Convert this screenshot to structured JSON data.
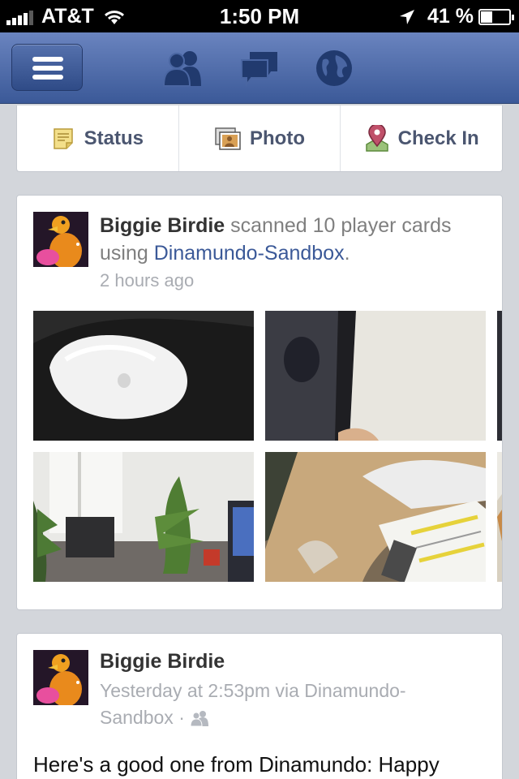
{
  "status_bar": {
    "carrier": "AT&T",
    "time": "1:50 PM",
    "battery_percent": "41 %"
  },
  "navbar": {
    "icons": [
      "menu-icon",
      "friends-icon",
      "messages-icon",
      "notifications-globe-icon"
    ]
  },
  "composer": {
    "status_label": "Status",
    "photo_label": "Photo",
    "checkin_label": "Check In"
  },
  "post1": {
    "author": "Biggie Birdie",
    "action": " scanned 10 player cards using ",
    "app": "Dinamundo-Sandbox",
    "period": ".",
    "time": "2 hours ago",
    "photos": [
      "magic-mouse",
      "tablet-screen",
      "office-plants",
      "desk-papers",
      "mouse-edge",
      "laptop-edge"
    ]
  },
  "post2": {
    "author": "Biggie Birdie",
    "meta_line1": "Yesterday at 2:53pm via Dinamundo-",
    "meta_line2": "Sandbox ·",
    "body": "Here's a good one from Dinamundo: Happy"
  },
  "colors": {
    "brand_blue": "#3b5998",
    "background": "#d3d6db"
  }
}
